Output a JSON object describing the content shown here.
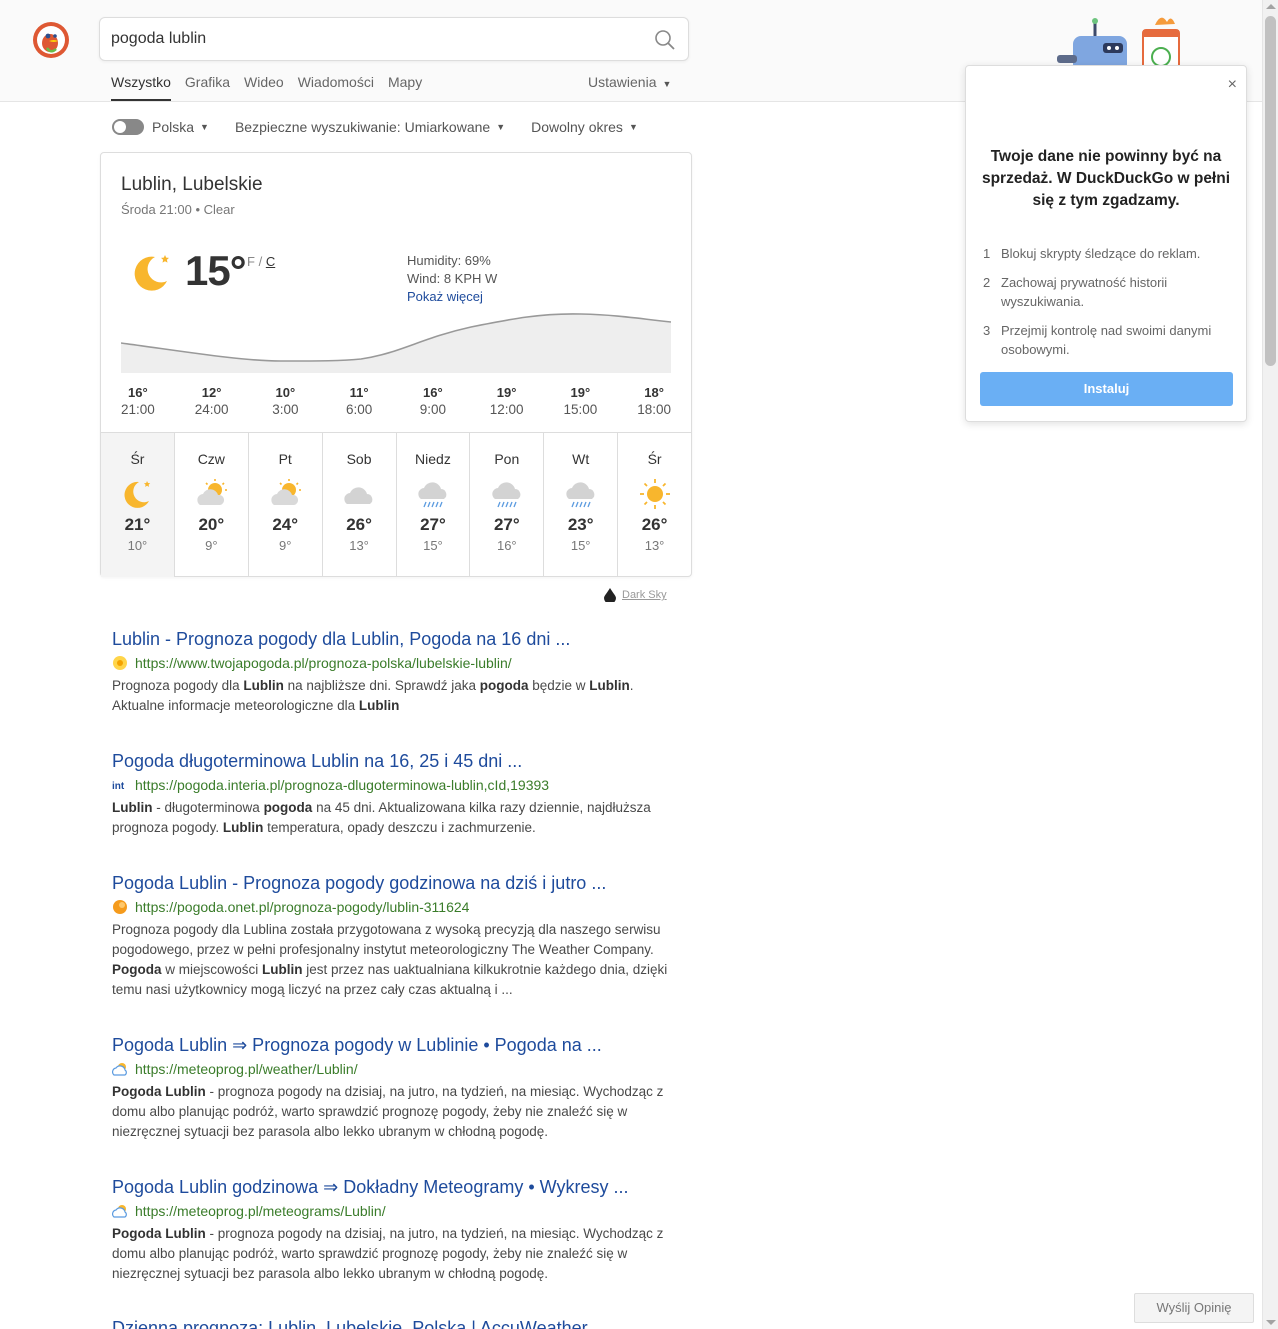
{
  "search": {
    "query": "pogoda lublin"
  },
  "nav": {
    "tabs": [
      "Wszystko",
      "Grafika",
      "Wideo",
      "Wiadomości",
      "Mapy"
    ],
    "settings": "Ustawienia"
  },
  "filters": {
    "region": "Polska",
    "safe_search": "Bezpieczne wyszukiwanie: Umiarkowane",
    "time": "Dowolny okres"
  },
  "weather": {
    "location": "Lublin, Lubelskie",
    "subtitle": "Środa 21:00 • Clear",
    "temperature": "15°",
    "unit_f": "F",
    "unit_sep": "/",
    "unit_c": "C",
    "humidity": "Humidity: 69%",
    "wind": "Wind: 8 KPH W",
    "more": "Pokaż więcej",
    "hourly": [
      {
        "temp": "16°",
        "time": "21:00"
      },
      {
        "temp": "12°",
        "time": "24:00"
      },
      {
        "temp": "10°",
        "time": "3:00"
      },
      {
        "temp": "11°",
        "time": "6:00"
      },
      {
        "temp": "16°",
        "time": "9:00"
      },
      {
        "temp": "19°",
        "time": "12:00"
      },
      {
        "temp": "19°",
        "time": "15:00"
      },
      {
        "temp": "18°",
        "time": "18:00"
      }
    ],
    "daily": [
      {
        "day": "Śr",
        "high": "21°",
        "low": "10°",
        "icon": "moon-icon"
      },
      {
        "day": "Czw",
        "high": "20°",
        "low": "9°",
        "icon": "partly-cloudy-icon"
      },
      {
        "day": "Pt",
        "high": "24°",
        "low": "9°",
        "icon": "partly-cloudy-icon"
      },
      {
        "day": "Sob",
        "high": "26°",
        "low": "13°",
        "icon": "cloud-icon"
      },
      {
        "day": "Niedz",
        "high": "27°",
        "low": "15°",
        "icon": "rain-icon"
      },
      {
        "day": "Pon",
        "high": "27°",
        "low": "16°",
        "icon": "rain-icon"
      },
      {
        "day": "Wt",
        "high": "23°",
        "low": "15°",
        "icon": "rain-icon"
      },
      {
        "day": "Śr",
        "high": "26°",
        "low": "13°",
        "icon": "sun-icon"
      }
    ],
    "attribution": "Dark Sky"
  },
  "results": [
    {
      "title": "Lublin - Prognoza pogody dla Lublin, Pogoda na 16 dni ...",
      "url": "https://www.twojapogoda.pl/prognoza-polska/lubelskie-lublin/",
      "snippet_parts": [
        [
          "Prognoza pogody dla ",
          false
        ],
        [
          "Lublin",
          true
        ],
        [
          " na najbliższe dni. Sprawdź jaka ",
          false
        ],
        [
          "pogoda",
          true
        ],
        [
          " będzie w ",
          false
        ],
        [
          "Lublin",
          true
        ],
        [
          ". Aktualne informacje meteorologiczne dla ",
          false
        ],
        [
          "Lublin",
          true
        ]
      ]
    },
    {
      "title": "Pogoda długoterminowa Lublin na 16, 25 i 45 dni ...",
      "url": "https://pogoda.interia.pl/prognoza-dlugoterminowa-lublin,cId,19393",
      "snippet_parts": [
        [
          "Lublin",
          true
        ],
        [
          " - długoterminowa ",
          false
        ],
        [
          "pogoda",
          true
        ],
        [
          " na 45 dni. Aktualizowana kilka razy dziennie, najdłuższa prognoza pogody. ",
          false
        ],
        [
          "Lublin",
          true
        ],
        [
          " temperatura, opady deszczu i zachmurzenie.",
          false
        ]
      ]
    },
    {
      "title": "Pogoda Lublin - Prognoza pogody godzinowa na dziś i jutro ...",
      "url": "https://pogoda.onet.pl/prognoza-pogody/lublin-311624",
      "snippet_parts": [
        [
          "Prognoza pogody dla Lublina została przygotowana z wysoką precyzją dla naszego serwisu pogodowego, przez w pełni profesjonalny instytut meteorologiczny The Weather Company. ",
          false
        ],
        [
          "Pogoda",
          true
        ],
        [
          " w miejscowości ",
          false
        ],
        [
          "Lublin",
          true
        ],
        [
          " jest przez nas uaktualniana kilkukrotnie każdego dnia, dzięki temu nasi użytkownicy mogą liczyć na przez cały czas aktualną i ...",
          false
        ]
      ]
    },
    {
      "title": "Pogoda Lublin ⇒ Prognoza pogody w Lublinie • Pogoda na ...",
      "url": "https://meteoprog.pl/weather/Lublin/",
      "snippet_parts": [
        [
          "Pogoda Lublin",
          true
        ],
        [
          " - prognoza pogody na dzisiaj, na jutro, na tydzień, na miesiąc. Wychodząc z domu albo planując podróż, warto sprawdzić prognozę pogody, żeby nie znaleźć się w niezręcznej sytuacji bez parasola albo lekko ubranym w chłodną pogodę.",
          false
        ]
      ]
    },
    {
      "title": "Pogoda Lublin godzinowa ⇒ Dokładny Meteogramy • Wykresy ...",
      "url": "https://meteoprog.pl/meteograms/Lublin/",
      "snippet_parts": [
        [
          "Pogoda Lublin",
          true
        ],
        [
          " - prognoza pogody na dzisiaj, na jutro, na tydzień, na miesiąc. Wychodząc z domu albo planując podróż, warto sprawdzić prognozę pogody, żeby nie znaleźć się w niezręcznej sytuacji bez parasola albo lekko ubranym w chłodną pogodę.",
          false
        ]
      ]
    },
    {
      "title": "Dzienna prognoza: Lublin, Lubelskie, Polska | AccuWeather",
      "url": "",
      "snippet_parts": []
    }
  ],
  "promo": {
    "heading": "Twoje dane nie powinny być na sprzedaż. W DuckDuckGo w pełni się z tym zgadzamy.",
    "items": [
      {
        "n": "1",
        "text": "Blokuj skrypty śledzące do reklam."
      },
      {
        "n": "2",
        "text": "Zachowaj prywatność historii wyszukiwania."
      },
      {
        "n": "3",
        "text": "Przejmij kontrolę nad swoimi danymi osobowymi."
      }
    ],
    "button": "Instaluj",
    "close": "×"
  },
  "feedback": "Wyślij Opinię"
}
